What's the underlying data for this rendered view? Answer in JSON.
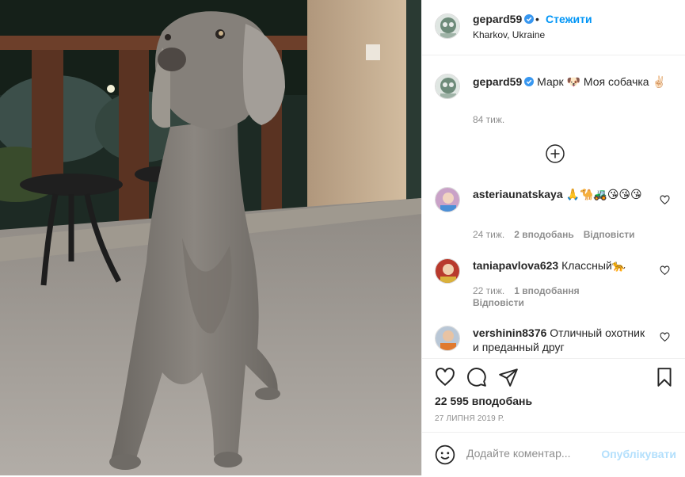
{
  "photo": {
    "alt_icon": "weimaraner-dog-photo"
  },
  "header": {
    "username": "gepard59",
    "separator": "•",
    "follow_label": "Стежити",
    "location": "Kharkov, Ukraine"
  },
  "caption": {
    "username": "gepard59",
    "text": "Марк 🐶 Моя собачка ✌🏻",
    "time": "84 тиж."
  },
  "comments": [
    {
      "username": "asteriaunatskaya",
      "text": "🙏🐪🚜😘😘😘",
      "time": "24 тиж.",
      "likes": "2 вподобань",
      "reply": "Відповісти"
    },
    {
      "username": "taniapavlova623",
      "text": "Классный🐆",
      "time": "22 тиж.",
      "likes": "1 вподобання",
      "reply": "Відповісти"
    },
    {
      "username": "vershinin8376",
      "text": "Отличный охотник и преданный друг",
      "time": "",
      "likes": "",
      "reply": ""
    }
  ],
  "actions": {
    "likes_count": "22 595 вподобань",
    "date": "27 ЛИПНЯ 2019 Р."
  },
  "add_comment": {
    "placeholder": "Додайте коментар...",
    "publish_label": "Опублікувати"
  },
  "colors": {
    "link_blue": "#0095f6",
    "publish_disabled": "#b2dffc",
    "muted": "#8e8e8e",
    "text": "#262626"
  }
}
